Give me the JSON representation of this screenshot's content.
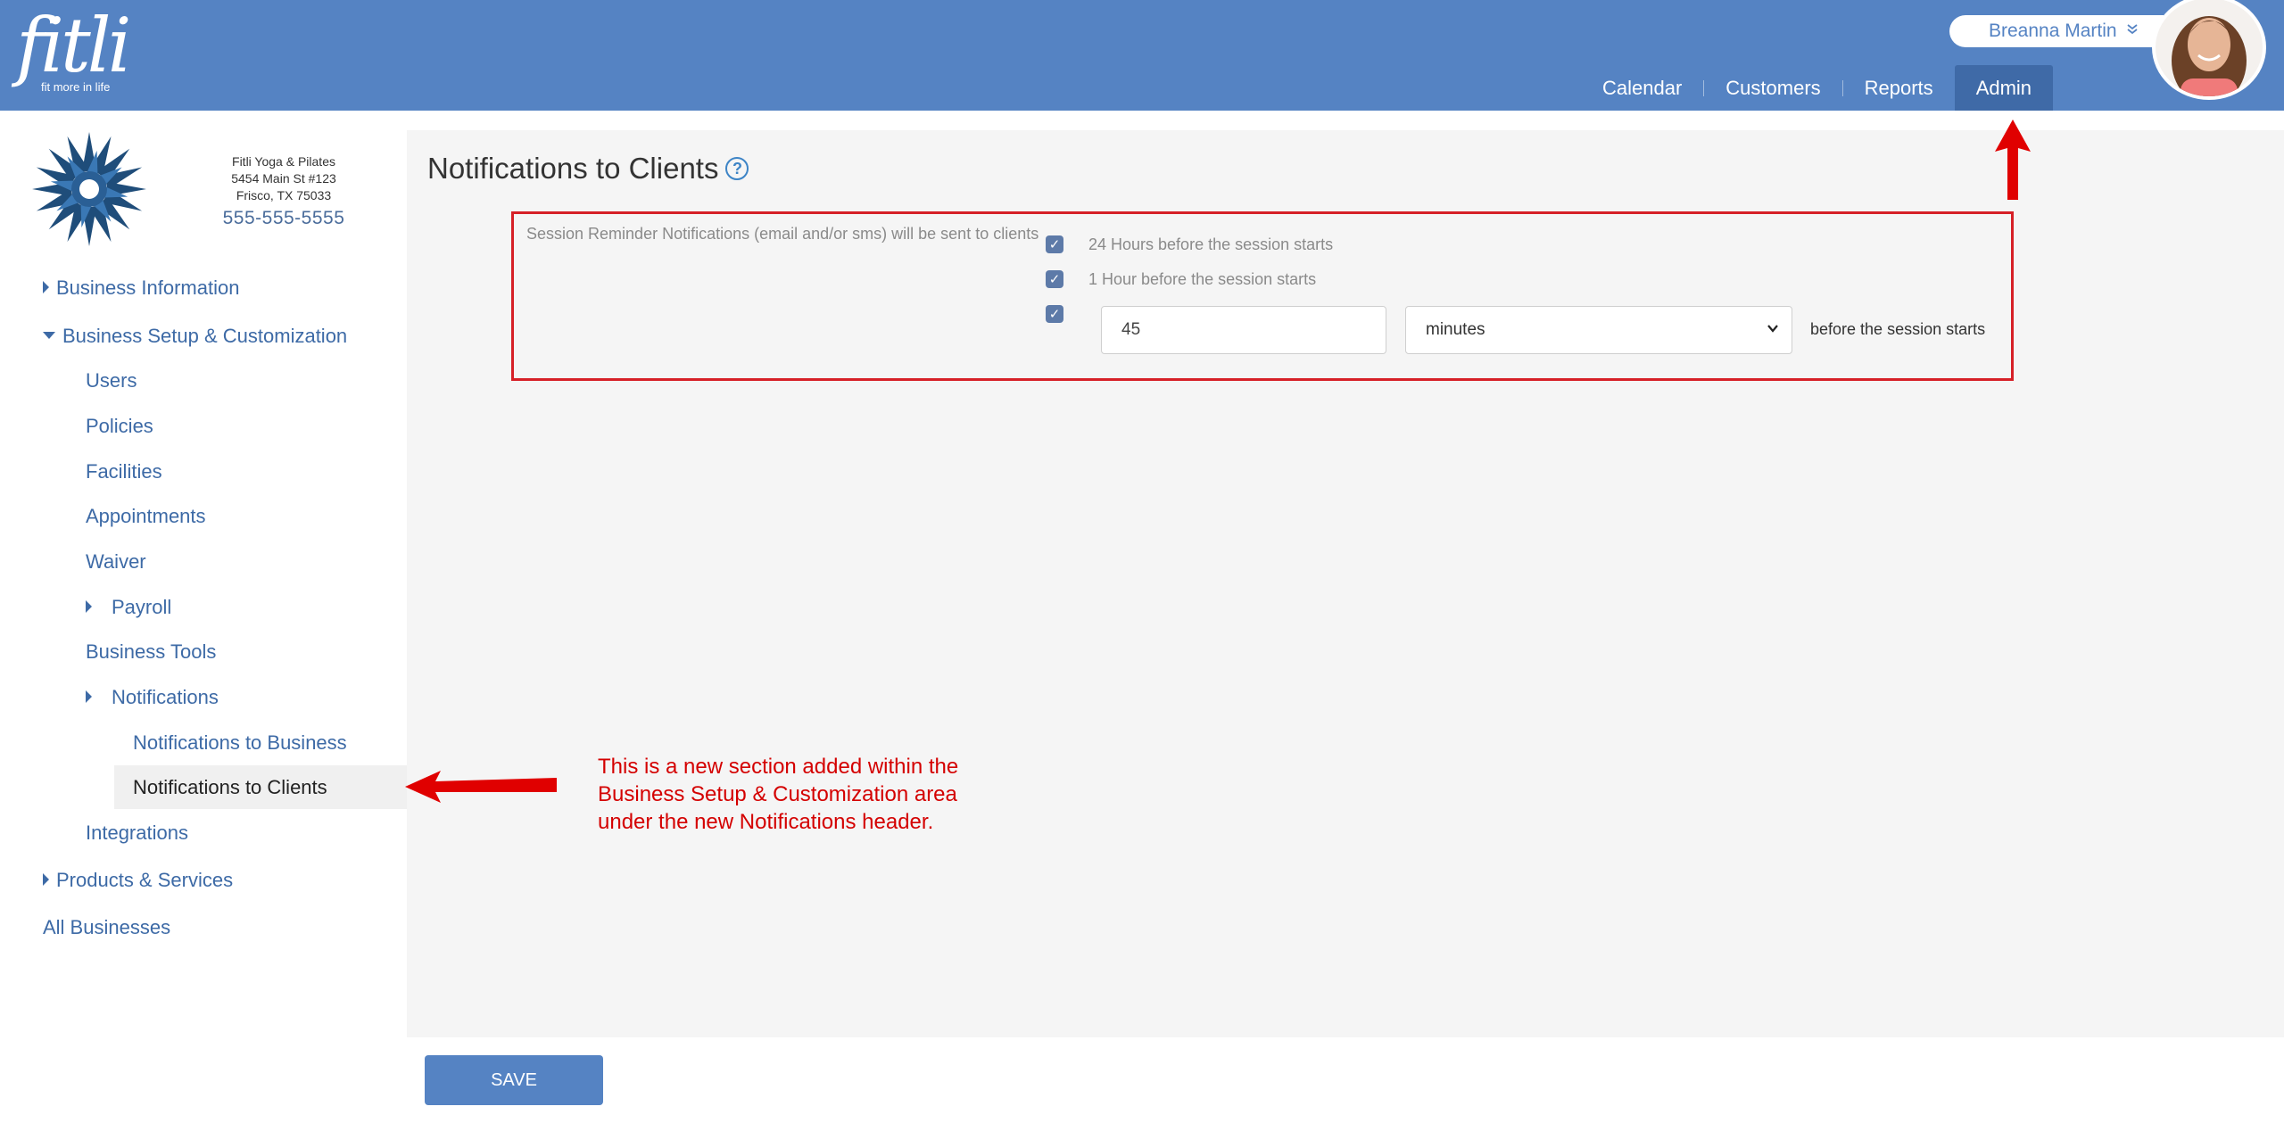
{
  "brand": {
    "logo_text": "fitli",
    "tagline": "fit more in life"
  },
  "user": {
    "name": "Breanna Martin"
  },
  "nav": {
    "items": [
      "Calendar",
      "Customers",
      "Reports",
      "Admin"
    ],
    "active": "Admin"
  },
  "business": {
    "name": "Fitli Yoga & Pilates",
    "address1": "5454 Main St #123",
    "address2": "Frisco, TX 75033",
    "phone": "555-555-5555"
  },
  "sidebar": {
    "business_information": "Business Information",
    "business_setup": "Business Setup & Customization",
    "users": "Users",
    "policies": "Policies",
    "facilities": "Facilities",
    "appointments": "Appointments",
    "waiver": "Waiver",
    "payroll": "Payroll",
    "business_tools": "Business Tools",
    "notifications": "Notifications",
    "notifications_to_business": "Notifications to Business",
    "notifications_to_clients": "Notifications to Clients",
    "integrations": "Integrations",
    "products_services": "Products & Services",
    "all_businesses": "All Businesses"
  },
  "main": {
    "title": "Notifications to Clients",
    "help_icon": "?",
    "reminder_label": "Session Reminder Notifications (email and/or sms) will be sent to clients",
    "options": [
      {
        "label": "24 Hours before the session starts",
        "checked": true
      },
      {
        "label": "1 Hour before the session starts",
        "checked": true
      },
      {
        "label": "",
        "checked": true
      }
    ],
    "custom_value": "45",
    "custom_unit": "minutes",
    "custom_suffix": "before the session starts",
    "save_label": "SAVE"
  },
  "annotation": {
    "line1": "This is a new section added within the",
    "line2": "Business Setup & Customization area",
    "line3": "under the new Notifications header."
  },
  "colors": {
    "header": "#5583c3",
    "nav_active": "#3f6aa7",
    "annotation": "#d40000",
    "link": "#3d6aa6"
  }
}
